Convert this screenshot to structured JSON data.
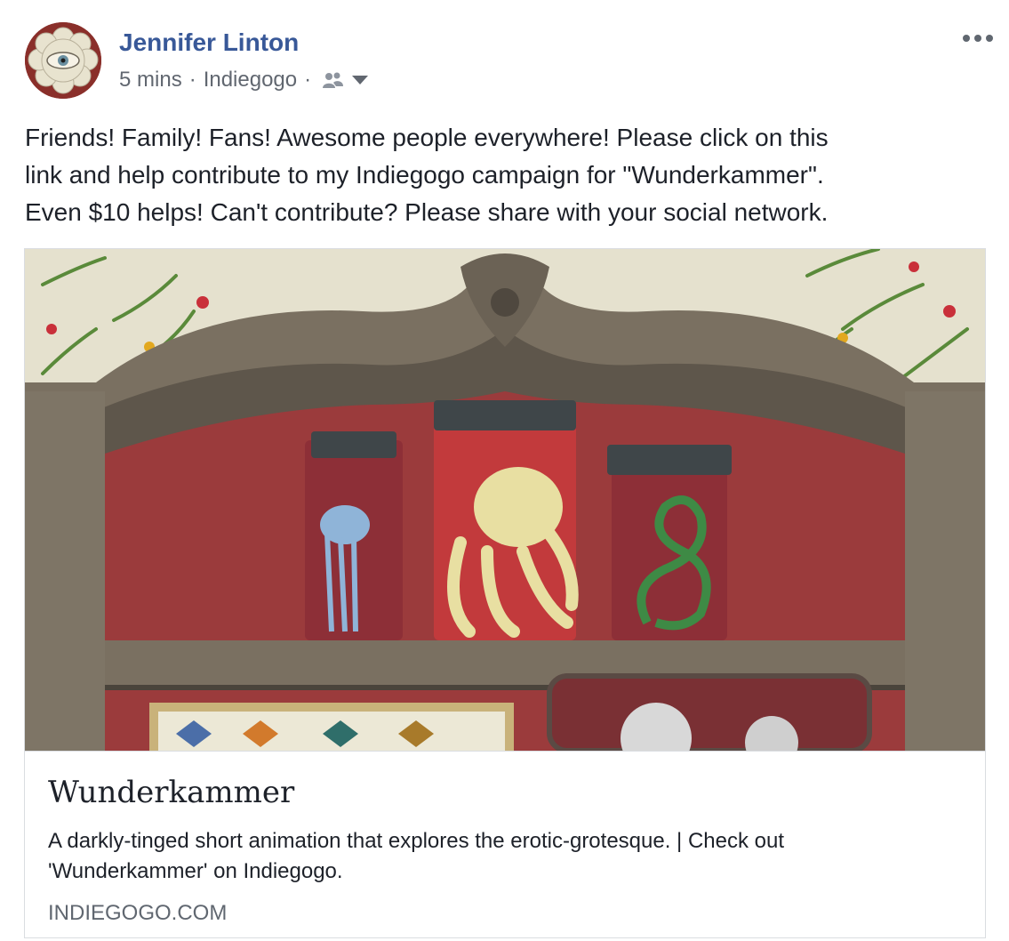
{
  "post": {
    "author": "Jennifer Linton",
    "time": "5 mins",
    "separator": "·",
    "source": "Indiegogo",
    "audience_icon": "friends-icon",
    "more_icon": "more-options-icon",
    "message": {
      "line1": "Friends! Family! Fans! Awesome people everywhere! Please click on this",
      "line2": "link and help contribute to my Indiegogo campaign for \"Wunderkammer\".",
      "line3": "Even $10 helps! Can't contribute? Please share with your social network."
    }
  },
  "link_card": {
    "title": "Wunderkammer",
    "description_line1": "A darkly-tinged short animation that explores the erotic-grotesque. | Check out",
    "description_line2": "'Wunderkammer' on Indiegogo.",
    "domain": "INDIEGOGO.COM"
  },
  "colors": {
    "author_link": "#385898",
    "meta_text": "#616770",
    "body_text": "#1d2129",
    "card_border": "#dadde1"
  }
}
